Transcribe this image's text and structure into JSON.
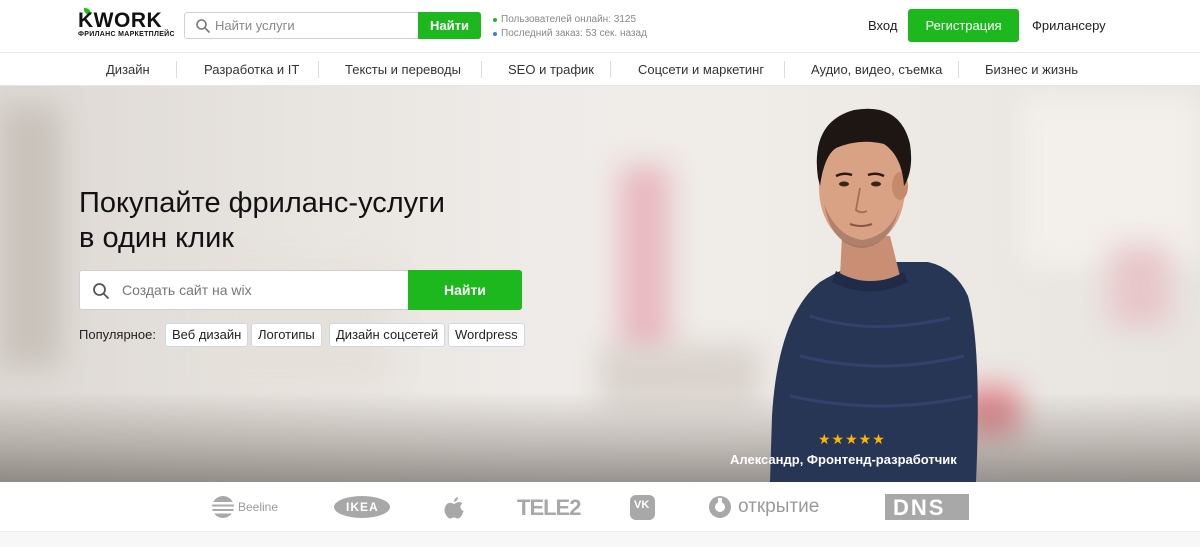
{
  "header": {
    "logo": {
      "main": "KWORK",
      "sub": "ФРИЛАНС МАРКЕТПЛЕЙС"
    },
    "search": {
      "placeholder": "Найти услуги",
      "button": "Найти"
    },
    "stats": [
      {
        "text": "Пользователей онлайн: 3125",
        "dot_color": "#1db81d"
      },
      {
        "text": "Последний заказ: 53 сек. назад",
        "dot_color": "#3b7ddd"
      }
    ],
    "login": "Вход",
    "register": "Регистрация",
    "freelancer": "Фрилансеру"
  },
  "categories": [
    "Дизайн",
    "Разработка и IT",
    "Тексты и переводы",
    "SEO и трафик",
    "Соцсети и маркетинг",
    "Аудио, видео, съемка",
    "Бизнес и жизнь"
  ],
  "hero": {
    "title_line1": "Покупайте фриланс-услуги",
    "title_line2": "в один клик",
    "search": {
      "placeholder": "Создать сайт на wix",
      "button": "Найти"
    },
    "popular_label": "Популярное:",
    "tags": [
      "Веб дизайн",
      "Логотипы",
      "Дизайн соцсетей",
      "Wordpress"
    ],
    "rating_stars": "★★★★★",
    "caption": "Александр, Фронтенд-разработчик"
  },
  "brands": [
    "Beeline",
    "IKEA",
    "Apple",
    "TELE2",
    "VK",
    "открытие",
    "DNS"
  ],
  "colors": {
    "accent": "#1db81d",
    "star": "#ffb400",
    "brand_gray": "#9a9a9a"
  }
}
